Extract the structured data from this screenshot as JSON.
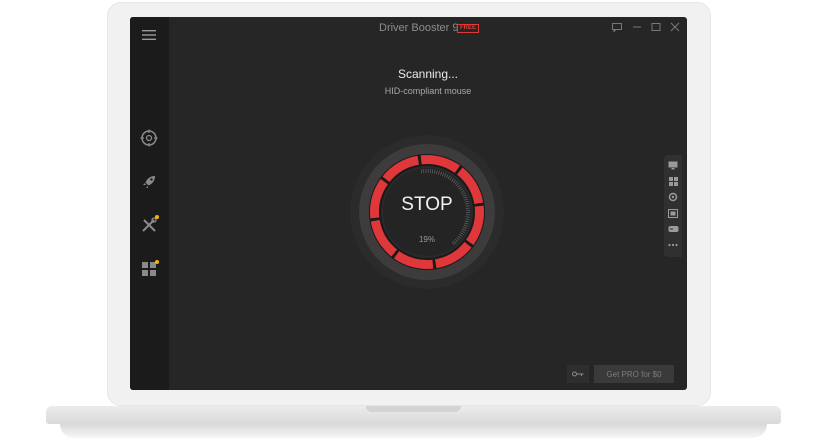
{
  "app": {
    "title": "Driver Booster 9",
    "badge": "FREE"
  },
  "scan": {
    "status": "Scanning...",
    "current_item": "HID-compliant mouse",
    "button_label": "STOP",
    "progress_text": "19%",
    "progress_fraction": 0.19
  },
  "sidebar": {
    "items": [
      {
        "icon": "menu-icon"
      },
      {
        "icon": "scan-target-icon"
      },
      {
        "icon": "rocket-icon",
        "notification": false
      },
      {
        "icon": "tools-icon",
        "notification": true
      },
      {
        "icon": "apps-grid-icon",
        "notification": true
      }
    ]
  },
  "right_panel": {
    "icons": [
      "monitor-icon",
      "windows-icon",
      "gear-chip-icon",
      "device-icon",
      "gamepad-icon",
      "more-icon"
    ]
  },
  "footer": {
    "pro_button_label": "Get PRO for $0",
    "key_icon": "key-icon"
  },
  "colors": {
    "accent_red": "#e0383a",
    "background": "#262626",
    "sidebar": "#1b1b1b",
    "badge": "#f5b400"
  }
}
